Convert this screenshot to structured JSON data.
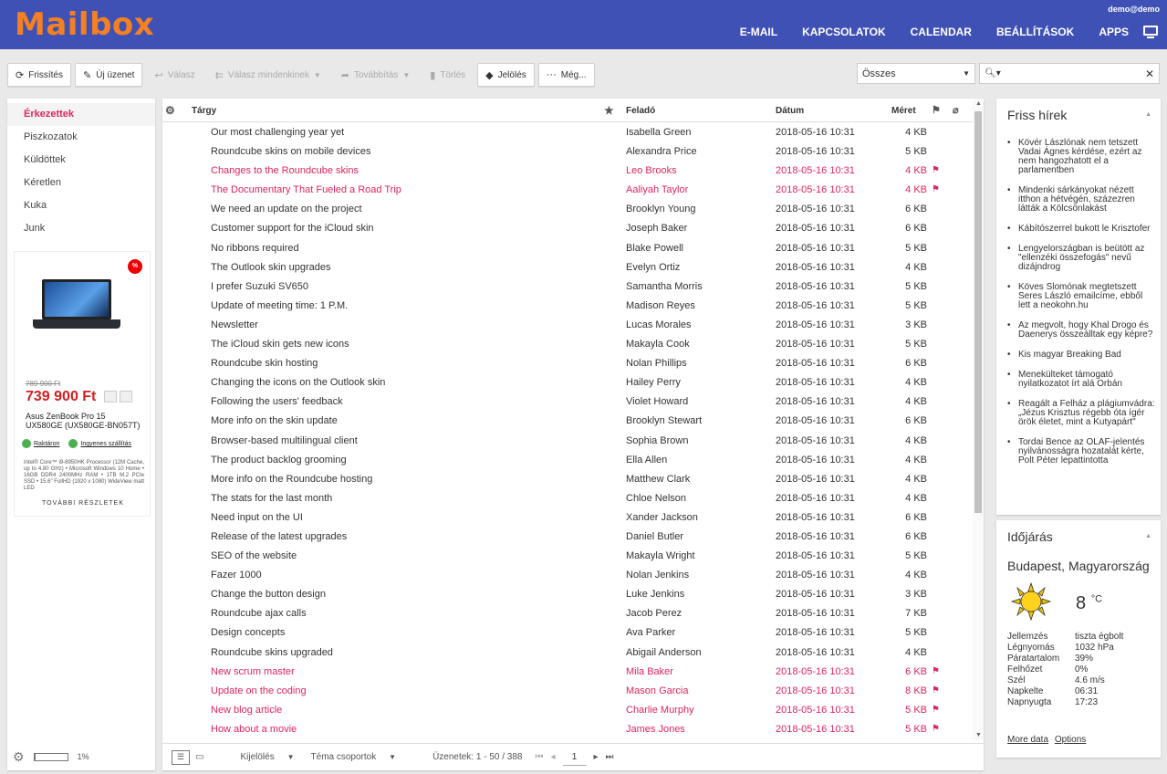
{
  "header": {
    "logo": "Mailbox",
    "user": "demo@demo",
    "nav": [
      "E-MAIL",
      "KAPCSOLATOK",
      "CALENDAR",
      "BEÁLLÍTÁSOK",
      "APPS"
    ]
  },
  "toolbar": {
    "refresh": "Frissítés",
    "compose": "Új üzenet",
    "reply": "Válasz",
    "reply_all": "Válasz mindenkinek",
    "forward": "Továbbítás",
    "delete": "Törlés",
    "mark": "Jelölés",
    "more": "Még..."
  },
  "filter": {
    "selected": "Összes"
  },
  "search": {
    "value": ""
  },
  "folders": [
    "Érkezettek",
    "Piszkozatok",
    "Küldöttek",
    "Kéretlen",
    "Kuka",
    "Junk"
  ],
  "ad": {
    "badge": "%",
    "old_price": "789 900 Ft",
    "price": "739 900 Ft",
    "name": "Asus ZenBook Pro 15 UX580GE (UX580GE-BN057T)",
    "tag1": "Raktáron",
    "tag2": "Ingyenes szállítás",
    "desc": "Intel® Core™ i9-8950HK Processor (12M Cache, up to 4.80 GHz) • Microsoft Windows 10 Home • 16GB DDR4 2400MHz RAM • 1TB M.2 PCIe SSD • 15.6\" FullHD (1920 x 1080) WideView matt LED",
    "more": "TOVÁBBI RÉSZLETEK"
  },
  "quota": {
    "text": "1%",
    "fraction": 0.01
  },
  "list": {
    "columns": {
      "subject": "Tárgy",
      "from": "Feladó",
      "date": "Dátum",
      "size": "Méret"
    },
    "messages": [
      {
        "subject": "Our most challenging year yet",
        "from": "Isabella Green",
        "date": "2018-05-16 10:31",
        "size": "4 KB",
        "flagged": false
      },
      {
        "subject": "Roundcube skins on mobile devices",
        "from": "Alexandra Price",
        "date": "2018-05-16 10:31",
        "size": "5 KB",
        "flagged": false
      },
      {
        "subject": "Changes to the Roundcube skins",
        "from": "Leo Brooks",
        "date": "2018-05-16 10:31",
        "size": "4 KB",
        "flagged": true
      },
      {
        "subject": "The Documentary That Fueled a Road Trip",
        "from": "Aaliyah Taylor",
        "date": "2018-05-16 10:31",
        "size": "4 KB",
        "flagged": true
      },
      {
        "subject": "We need an update on the project",
        "from": "Brooklyn Young",
        "date": "2018-05-16 10:31",
        "size": "6 KB",
        "flagged": false
      },
      {
        "subject": "Customer support for the iCloud skin",
        "from": "Joseph Baker",
        "date": "2018-05-16 10:31",
        "size": "6 KB",
        "flagged": false
      },
      {
        "subject": "No ribbons required",
        "from": "Blake Powell",
        "date": "2018-05-16 10:31",
        "size": "5 KB",
        "flagged": false
      },
      {
        "subject": "The Outlook skin upgrades",
        "from": "Evelyn Ortiz",
        "date": "2018-05-16 10:31",
        "size": "4 KB",
        "flagged": false
      },
      {
        "subject": "I prefer Suzuki SV650",
        "from": "Samantha Morris",
        "date": "2018-05-16 10:31",
        "size": "5 KB",
        "flagged": false
      },
      {
        "subject": "Update of meeting time: 1 P.M.",
        "from": "Madison Reyes",
        "date": "2018-05-16 10:31",
        "size": "5 KB",
        "flagged": false
      },
      {
        "subject": "Newsletter",
        "from": "Lucas Morales",
        "date": "2018-05-16 10:31",
        "size": "3 KB",
        "flagged": false
      },
      {
        "subject": "The iCloud skin gets new icons",
        "from": "Makayla Cook",
        "date": "2018-05-16 10:31",
        "size": "5 KB",
        "flagged": false
      },
      {
        "subject": "Roundcube skin hosting",
        "from": "Nolan Phillips",
        "date": "2018-05-16 10:31",
        "size": "6 KB",
        "flagged": false
      },
      {
        "subject": "Changing the icons on the Outlook skin",
        "from": "Hailey Perry",
        "date": "2018-05-16 10:31",
        "size": "4 KB",
        "flagged": false
      },
      {
        "subject": "Following the users' feedback",
        "from": "Violet Howard",
        "date": "2018-05-16 10:31",
        "size": "4 KB",
        "flagged": false
      },
      {
        "subject": "More info on the skin update",
        "from": "Brooklyn Stewart",
        "date": "2018-05-16 10:31",
        "size": "6 KB",
        "flagged": false
      },
      {
        "subject": "Browser-based multilingual client",
        "from": "Sophia Brown",
        "date": "2018-05-16 10:31",
        "size": "4 KB",
        "flagged": false
      },
      {
        "subject": "The product backlog grooming",
        "from": "Ella Allen",
        "date": "2018-05-16 10:31",
        "size": "4 KB",
        "flagged": false
      },
      {
        "subject": "More info on the Roundcube hosting",
        "from": "Matthew Clark",
        "date": "2018-05-16 10:31",
        "size": "4 KB",
        "flagged": false
      },
      {
        "subject": "The stats for the last month",
        "from": "Chloe Nelson",
        "date": "2018-05-16 10:31",
        "size": "4 KB",
        "flagged": false
      },
      {
        "subject": "Need input on the UI",
        "from": "Xander Jackson",
        "date": "2018-05-16 10:31",
        "size": "6 KB",
        "flagged": false
      },
      {
        "subject": "Release of the latest upgrades",
        "from": "Daniel Butler",
        "date": "2018-05-16 10:31",
        "size": "6 KB",
        "flagged": false
      },
      {
        "subject": "SEO of the website",
        "from": "Makayla Wright",
        "date": "2018-05-16 10:31",
        "size": "5 KB",
        "flagged": false
      },
      {
        "subject": "Fazer 1000",
        "from": "Nolan Jenkins",
        "date": "2018-05-16 10:31",
        "size": "4 KB",
        "flagged": false
      },
      {
        "subject": "Change the button design",
        "from": "Luke Jenkins",
        "date": "2018-05-16 10:31",
        "size": "3 KB",
        "flagged": false
      },
      {
        "subject": "Roundcube ajax calls",
        "from": "Jacob Perez",
        "date": "2018-05-16 10:31",
        "size": "7 KB",
        "flagged": false
      },
      {
        "subject": "Design concepts",
        "from": "Ava Parker",
        "date": "2018-05-16 10:31",
        "size": "5 KB",
        "flagged": false
      },
      {
        "subject": "Roundcube skins upgraded",
        "from": "Abigail Anderson",
        "date": "2018-05-16 10:31",
        "size": "4 KB",
        "flagged": false
      },
      {
        "subject": "New scrum master",
        "from": "Mila Baker",
        "date": "2018-05-16 10:31",
        "size": "6 KB",
        "flagged": true
      },
      {
        "subject": "Update on the coding",
        "from": "Mason Garcia",
        "date": "2018-05-16 10:31",
        "size": "8 KB",
        "flagged": true
      },
      {
        "subject": "New blog article",
        "from": "Charlie Murphy",
        "date": "2018-05-16 10:31",
        "size": "5 KB",
        "flagged": true
      },
      {
        "subject": "How about a movie",
        "from": "James Jones",
        "date": "2018-05-16 10:31",
        "size": "5 KB",
        "flagged": true
      }
    ],
    "footer": {
      "select": "Kijelölés",
      "threads": "Téma csoportok",
      "count": "Üzenetek: 1 - 50 / 388",
      "page": "1"
    }
  },
  "news": {
    "title": "Friss hírek",
    "items": [
      "Kövér Lászlónak nem tetszett Vadai Ágnes kérdése, ezért az nem hangozhatott el a parlamentben",
      "Mindenki sárkányokat nézett itthon a hétvégén, százezren látták a Kölcsönlakást",
      "Kábítószerrel bukott le Krisztofer",
      "Lengyelországban is beütött az \"ellenzéki összefogás\" nevű dizájndrog",
      "Köves Slomónak megtetszett Seres László emailcíme, ebből lett a neokohn.hu",
      "Az megvolt, hogy Khal Drogo és Daenerys összeálltak egy képre?",
      "Kis magyar Breaking Bad",
      "Menekülteket támogató nyilatkozatot írt alá Orbán",
      "Reagált a Felház a plágiumvádra: „Jézus Krisztus régebb óta ígér örök életet, mint a Kutyapárt\"",
      "Tordai Bence az OLAF-jelentés nyilvánosságra hozatalát kérte, Polt Péter lepattintotta"
    ]
  },
  "weather": {
    "title": "Időjárás",
    "city": "Budapest, Magyarország",
    "temp": "8",
    "unit": "°C",
    "rows": [
      {
        "k": "Jellemzés",
        "v": "tiszta égbolt"
      },
      {
        "k": "Légnyomás",
        "v": "1032 hPa"
      },
      {
        "k": "Páratartalom",
        "v": "39%"
      },
      {
        "k": "Felhőzet",
        "v": "0%"
      },
      {
        "k": "Szél",
        "v": "4.6 m/s"
      },
      {
        "k": "Napkelte",
        "v": "06:31"
      },
      {
        "k": "Napnyugta",
        "v": "17:23"
      }
    ],
    "more": "More data",
    "options": "Options"
  },
  "colors": {
    "header": "#3f51b5",
    "logo": "#f48024",
    "accent": "#e0245e"
  }
}
